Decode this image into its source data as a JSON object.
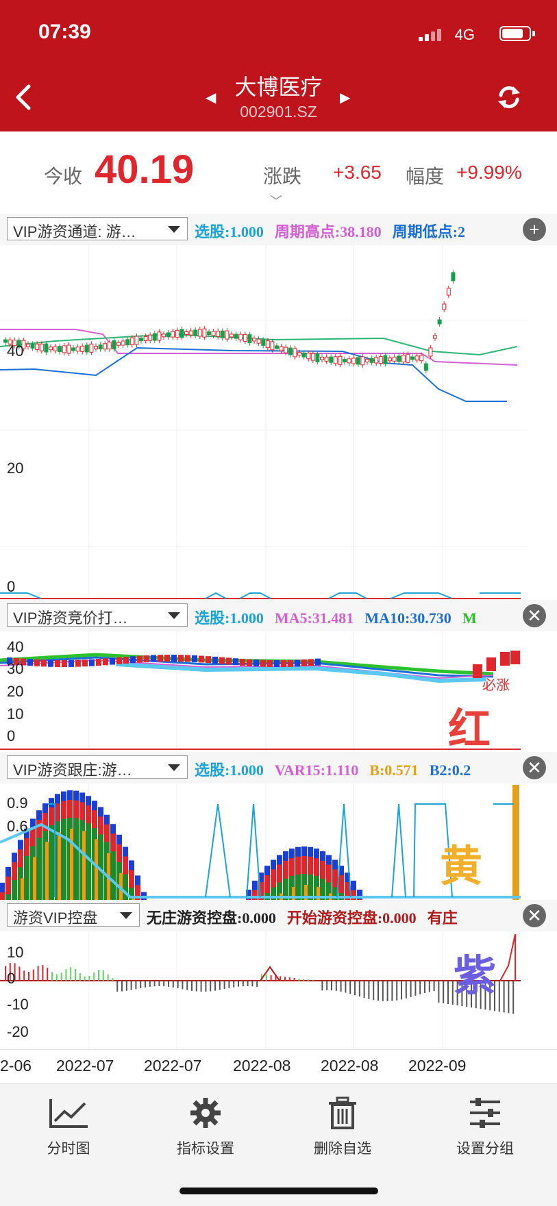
{
  "status": {
    "time": "07:39",
    "network": "4G"
  },
  "header": {
    "title": "大博医疗",
    "code": "002901.SZ"
  },
  "quote": {
    "close_label": "今收",
    "close": "40.19",
    "change_label": "涨跌",
    "change": "+3.65",
    "pct_label": "幅度",
    "pct": "+9.99%"
  },
  "indicators": [
    {
      "selector": "VIP游资通道: 游…",
      "values": [
        {
          "text": "选股:1.000",
          "color": "#1aa3d6"
        },
        {
          "text": "周期高点:38.180",
          "color": "#d35fd3"
        },
        {
          "text": "周期低点:2",
          "color": "#1a6fd6"
        }
      ]
    },
    {
      "selector": "VIP游资竞价打…",
      "values": [
        {
          "text": "选股:1.000",
          "color": "#1aa3d6"
        },
        {
          "text": "MA5:31.481",
          "color": "#d35fd3"
        },
        {
          "text": "MA10:30.730",
          "color": "#1a6fd6"
        },
        {
          "text": "M",
          "color": "#2ec12e"
        }
      ]
    },
    {
      "selector": "VIP游资跟庄:游…",
      "values": [
        {
          "text": "选股:1.000",
          "color": "#1aa3d6"
        },
        {
          "text": "VAR15:1.110",
          "color": "#d35fd3"
        },
        {
          "text": "B:0.571",
          "color": "#e3a11b"
        },
        {
          "text": "B2:0.2",
          "color": "#1a6fd6"
        }
      ]
    },
    {
      "selector": "游资VIP控盘",
      "values": [
        {
          "text": "无庄游资控盘:0.000",
          "color": "#222222"
        },
        {
          "text": "开始游资控盘:0.000",
          "color": "#b01a1a"
        },
        {
          "text": "有庄",
          "color": "#b01a1a"
        }
      ]
    }
  ],
  "chart1": {
    "y_labels": [
      "40",
      "20",
      "0"
    ]
  },
  "chart2": {
    "y_labels": [
      "40",
      "30",
      "20",
      "10",
      "0"
    ],
    "annotation": "必涨",
    "big_label": "红"
  },
  "chart3": {
    "y_labels": [
      "0.9",
      "0.6"
    ],
    "big_label": "黄"
  },
  "chart4": {
    "y_labels": [
      "10",
      "0",
      "-10",
      "-20"
    ],
    "big_label": "紫"
  },
  "x_axis": [
    "2-06",
    "2022-07",
    "2022-07",
    "2022-08",
    "2022-08",
    "2022-09"
  ],
  "tabs": [
    {
      "label": "分时图"
    },
    {
      "label": "指标设置"
    },
    {
      "label": "删除自选"
    },
    {
      "label": "设置分组"
    }
  ]
}
